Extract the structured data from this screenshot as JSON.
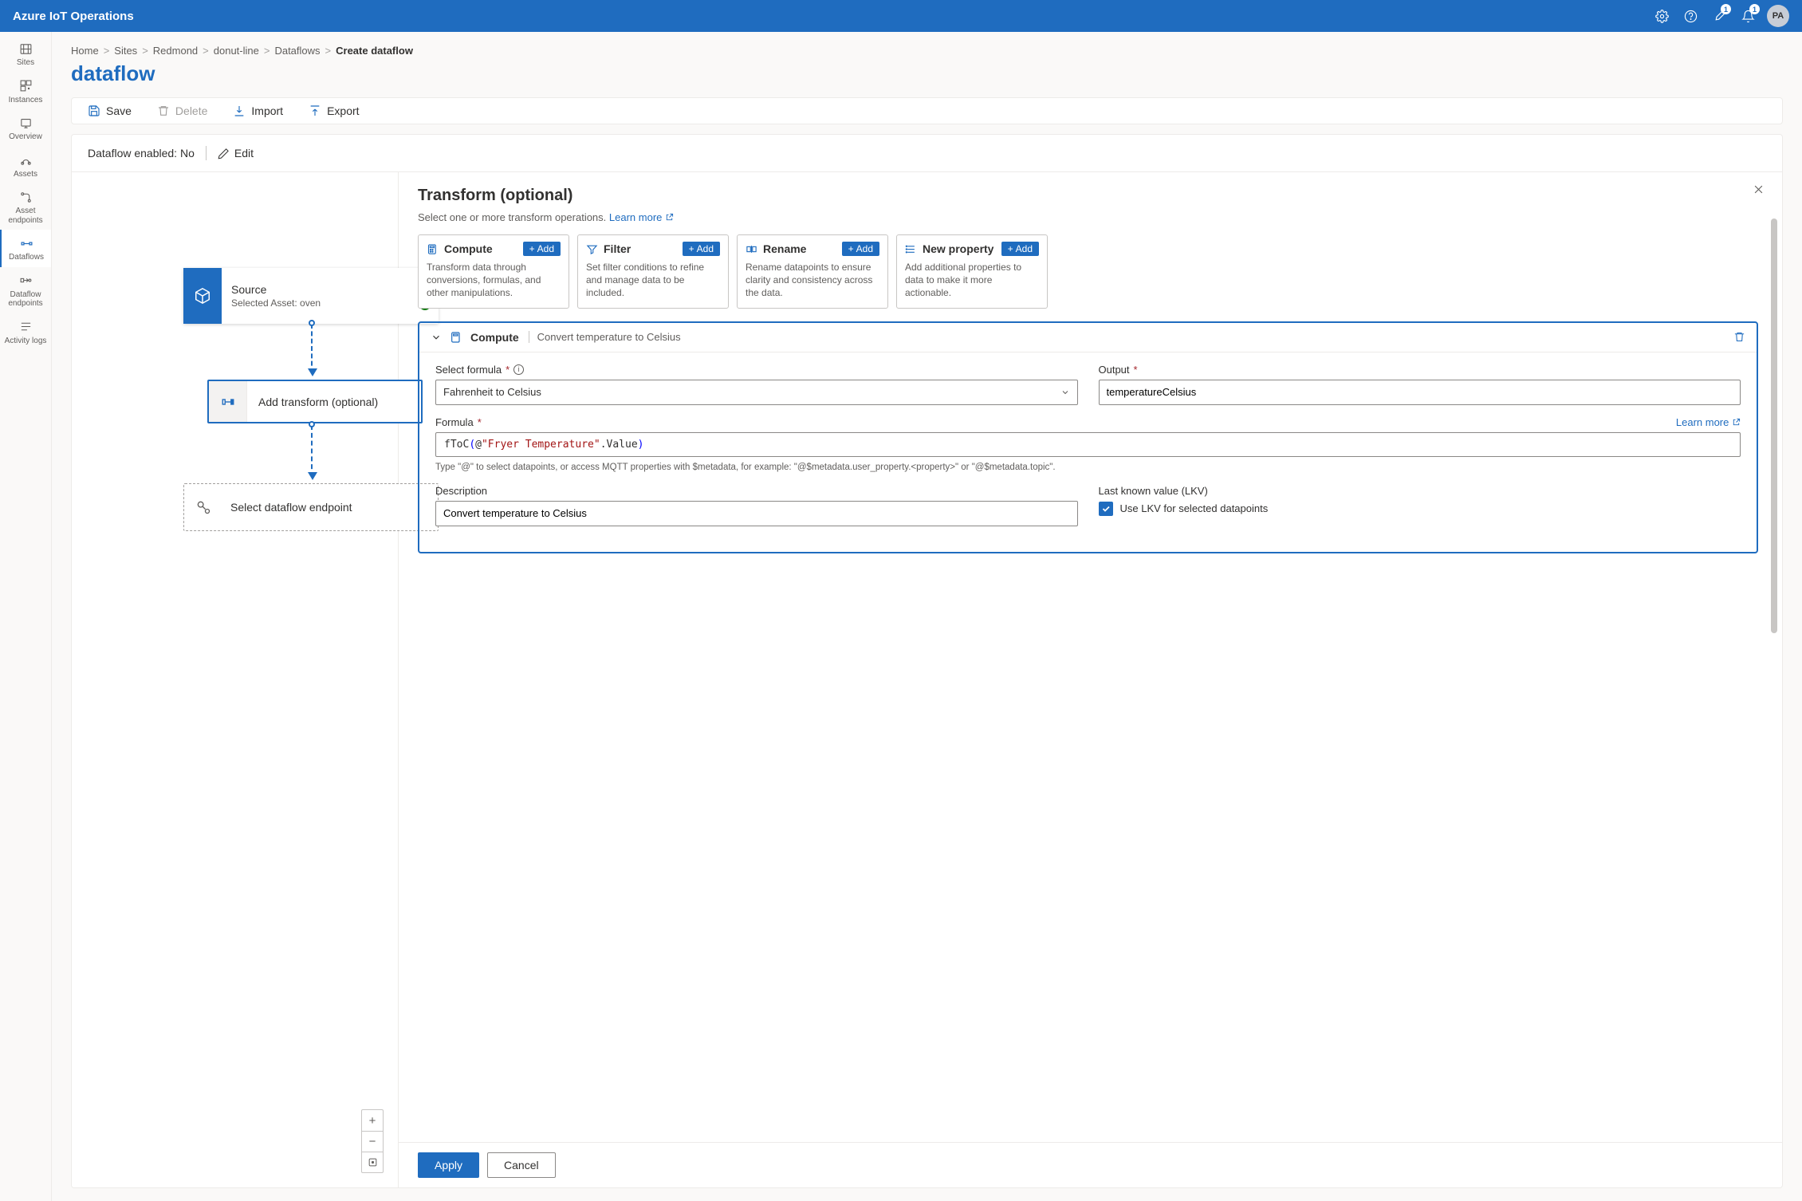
{
  "topbar": {
    "title": "Azure IoT Operations",
    "badge1": "1",
    "badge2": "1",
    "avatar": "PA"
  },
  "sidenav": {
    "items": [
      {
        "label": "Sites"
      },
      {
        "label": "Instances"
      },
      {
        "label": "Overview"
      },
      {
        "label": "Assets"
      },
      {
        "label": "Asset endpoints"
      },
      {
        "label": "Dataflows"
      },
      {
        "label": "Dataflow endpoints"
      },
      {
        "label": "Activity logs"
      }
    ]
  },
  "breadcrumb": {
    "items": [
      "Home",
      "Sites",
      "Redmond",
      "donut-line",
      "Dataflows"
    ],
    "current": "Create dataflow"
  },
  "page": {
    "title": "dataflow"
  },
  "commands": {
    "save": "Save",
    "delete": "Delete",
    "import": "Import",
    "export": "Export"
  },
  "enabled": {
    "label": "Dataflow enabled: No",
    "edit": "Edit"
  },
  "canvas": {
    "source": {
      "title": "Source",
      "subtitle": "Selected Asset: oven"
    },
    "transform": {
      "label": "Add transform (optional)"
    },
    "endpoint": {
      "label": "Select dataflow endpoint"
    }
  },
  "panel": {
    "title": "Transform (optional)",
    "subtitle": "Select one or more transform operations.",
    "learn_more": "Learn more",
    "cards": {
      "compute": {
        "label": "Compute",
        "add": "Add",
        "desc": "Transform data through conversions, formulas, and other manipulations."
      },
      "filter": {
        "label": "Filter",
        "add": "Add",
        "desc": "Set filter conditions to refine and manage data to be included."
      },
      "rename": {
        "label": "Rename",
        "add": "Add",
        "desc": "Rename datapoints to ensure clarity and consistency across the data."
      },
      "newprop": {
        "label": "New property",
        "add": "Add",
        "desc": "Add additional properties to data to make it more actionable."
      }
    },
    "compute_block": {
      "title": "Compute",
      "name": "Convert temperature to Celsius",
      "select_formula_label": "Select formula",
      "select_formula_value": "Fahrenheit to Celsius",
      "output_label": "Output",
      "output_value": "temperatureCelsius",
      "formula_label": "Formula",
      "learn_more": "Learn more",
      "formula_fn": "fToC",
      "formula_str": "\"Fryer Temperature\"",
      "formula_prop": ".Value",
      "formula_hint": "Type \"@\" to select datapoints, or access MQTT properties with $metadata, for example: \"@$metadata.user_property.<property>\" or \"@$metadata.topic\".",
      "description_label": "Description",
      "description_value": "Convert temperature to Celsius",
      "lkv_label": "Last known value (LKV)",
      "lkv_checkbox": "Use LKV for selected datapoints"
    },
    "footer": {
      "apply": "Apply",
      "cancel": "Cancel"
    }
  }
}
